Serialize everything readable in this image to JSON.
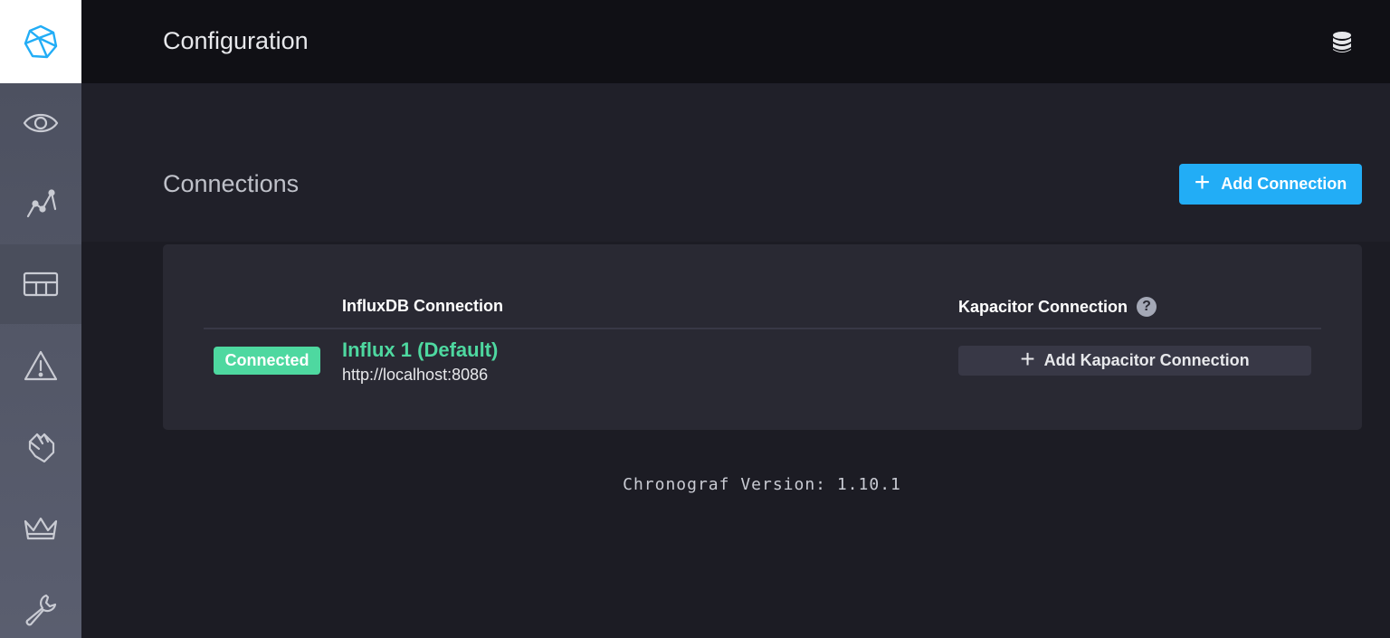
{
  "header": {
    "title": "Configuration",
    "right_icon": "database-icon"
  },
  "sidebar": {
    "logo_icon": "chronograf-logo-icon",
    "items": [
      {
        "icon": "eye-icon",
        "active": false
      },
      {
        "icon": "graph-icon",
        "active": false
      },
      {
        "icon": "dashboard-grid-icon",
        "active": true
      },
      {
        "icon": "alert-triangle-icon",
        "active": false
      },
      {
        "icon": "data-explorer-hand-icon",
        "active": false
      },
      {
        "icon": "crown-icon",
        "active": false
      },
      {
        "icon": "wrench-icon",
        "active": false
      }
    ]
  },
  "main": {
    "section_title": "Connections",
    "add_connection_label": "Add Connection",
    "columns": {
      "influx": "InfluxDB Connection",
      "kapacitor": "Kapacitor Connection",
      "help_glyph": "?"
    },
    "connections": [
      {
        "status": "Connected",
        "name": "Influx 1 (Default)",
        "url": "http://localhost:8086",
        "kapacitor_action": "Add Kapacitor Connection"
      }
    ],
    "version": "Chronograf Version: 1.10.1"
  },
  "colors": {
    "accent": "#22adf6",
    "success": "#4ed8a0",
    "header_bg": "#101015",
    "page_bg": "#1c1c24",
    "panel_bg": "#292933"
  }
}
